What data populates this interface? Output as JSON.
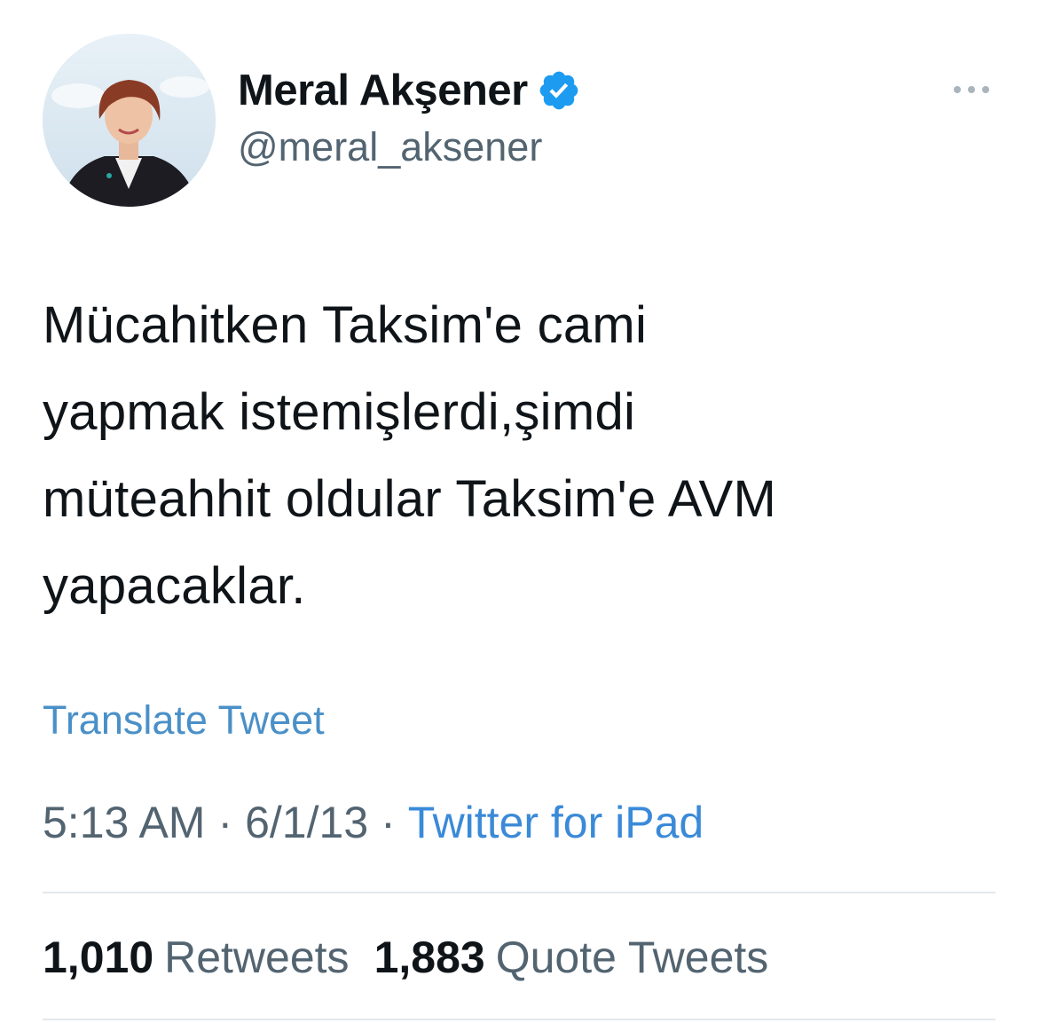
{
  "author": {
    "display_name": "Meral Akşener",
    "handle": "@meral_aksener",
    "avatar_icon": "profile-photo",
    "verified_icon": "verified-badge-icon",
    "verified_color": "#1d9bf0"
  },
  "more_icon": "more-options-icon",
  "tweet": {
    "lines": [
      "Mücahitken Taksim'e cami",
      "yapmak istemişlerdi,şimdi",
      "müteahhit oldular Taksim'e AVM",
      "yapacaklar."
    ],
    "translate_label": "Translate Tweet",
    "time": "5:13 AM",
    "date": "6/1/13",
    "separator": "·",
    "source": "Twitter for iPad"
  },
  "stats": {
    "retweets_count": "1,010",
    "retweets_label": "Retweets",
    "quotes_count": "1,883",
    "quotes_label": "Quote Tweets"
  },
  "colors": {
    "link": "#4a90c8",
    "secondary_text": "#536471",
    "primary_text": "#0f1419"
  }
}
